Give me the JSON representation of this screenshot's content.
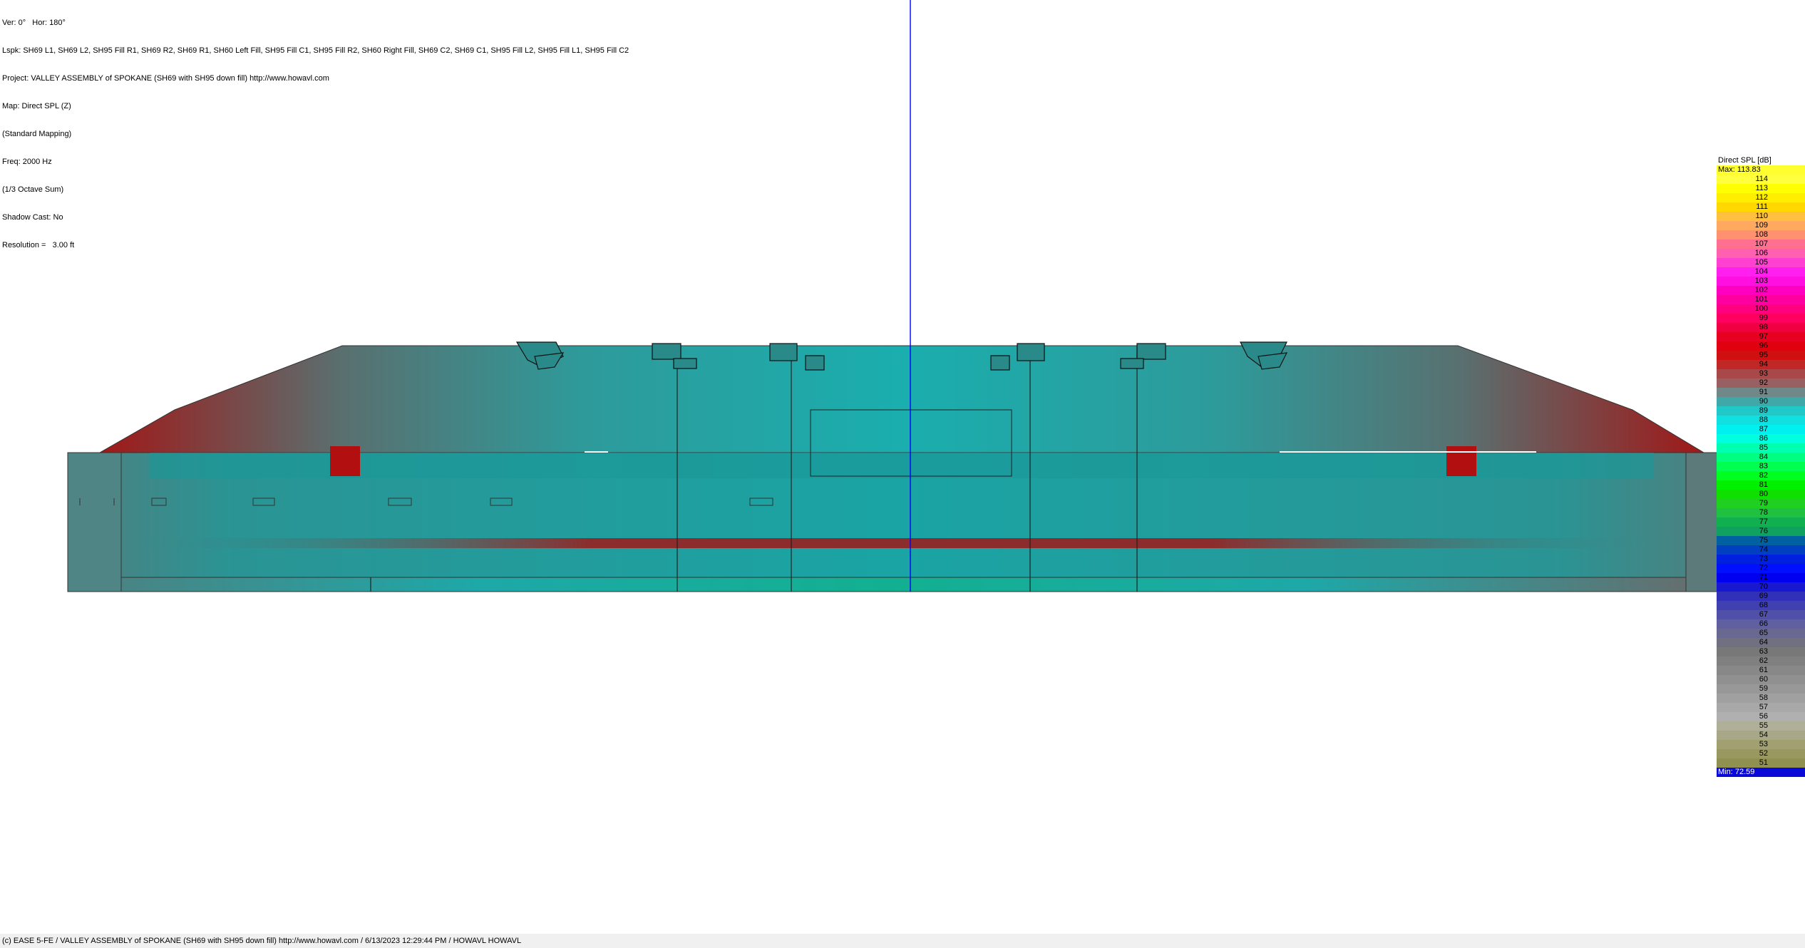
{
  "info_lines": [
    "Ver: 0°   Hor: 180°",
    "Lspk: SH69 L1, SH69 L2, SH95 Fill R1, SH69 R2, SH69 R1, SH60 Left Fill, SH95 Fill C1, SH95 Fill R2, SH60 Right Fill, SH69 C2, SH69 C1, SH95 Fill L2, SH95 Fill L1, SH95 Fill C2",
    "Project: VALLEY ASSEMBLY of SPOKANE (SH69 with SH95 down fill) http://www.howavl.com",
    "Map: Direct SPL (Z)",
    "(Standard Mapping)",
    "Freq: 2000 Hz",
    "(1/3 Octave Sum)",
    "Shadow Cast: No",
    "Resolution =   3.00 ft"
  ],
  "legend": {
    "title": "Direct SPL [dB]",
    "max": "Max:  113.83",
    "min": "Min:  72.59",
    "rows": [
      {
        "label": "114",
        "color": "#ffff40"
      },
      {
        "label": "113",
        "color": "#ffff00"
      },
      {
        "label": "112",
        "color": "#ffee00"
      },
      {
        "label": "111",
        "color": "#ffd800"
      },
      {
        "label": "110",
        "color": "#ffc040"
      },
      {
        "label": "109",
        "color": "#ffa860"
      },
      {
        "label": "108",
        "color": "#ff9070"
      },
      {
        "label": "107",
        "color": "#ff7090"
      },
      {
        "label": "106",
        "color": "#ff60b0"
      },
      {
        "label": "105",
        "color": "#ff40d0"
      },
      {
        "label": "104",
        "color": "#ff20f0"
      },
      {
        "label": "103",
        "color": "#ff10e0"
      },
      {
        "label": "102",
        "color": "#ff00c0"
      },
      {
        "label": "101",
        "color": "#ff00a0"
      },
      {
        "label": "100",
        "color": "#ff0080"
      },
      {
        "label": "99",
        "color": "#ff0060"
      },
      {
        "label": "98",
        "color": "#f00040"
      },
      {
        "label": "97",
        "color": "#e80020"
      },
      {
        "label": "96",
        "color": "#e00010"
      },
      {
        "label": "95",
        "color": "#d01010"
      },
      {
        "label": "94",
        "color": "#c02828"
      },
      {
        "label": "93",
        "color": "#a84848"
      },
      {
        "label": "92",
        "color": "#986060"
      },
      {
        "label": "91",
        "color": "#708888"
      },
      {
        "label": "90",
        "color": "#40a8a8"
      },
      {
        "label": "89",
        "color": "#20c8c8"
      },
      {
        "label": "88",
        "color": "#10e0e0"
      },
      {
        "label": "87",
        "color": "#00f0f0"
      },
      {
        "label": "86",
        "color": "#00ffe0"
      },
      {
        "label": "85",
        "color": "#00ffb0"
      },
      {
        "label": "84",
        "color": "#00ff80"
      },
      {
        "label": "83",
        "color": "#00ff50"
      },
      {
        "label": "82",
        "color": "#00ff20"
      },
      {
        "label": "81",
        "color": "#00f000"
      },
      {
        "label": "80",
        "color": "#10e000"
      },
      {
        "label": "79",
        "color": "#20d020"
      },
      {
        "label": "78",
        "color": "#20c040"
      },
      {
        "label": "77",
        "color": "#10b050"
      },
      {
        "label": "76",
        "color": "#10a060"
      },
      {
        "label": "75",
        "color": "#0060a0"
      },
      {
        "label": "74",
        "color": "#0040c0"
      },
      {
        "label": "73",
        "color": "#0020e0"
      },
      {
        "label": "72",
        "color": "#0010ff"
      },
      {
        "label": "71",
        "color": "#0000f0"
      },
      {
        "label": "70",
        "color": "#1818d0"
      },
      {
        "label": "69",
        "color": "#3030b8"
      },
      {
        "label": "68",
        "color": "#4040b0"
      },
      {
        "label": "67",
        "color": "#5050a8"
      },
      {
        "label": "66",
        "color": "#6060a0"
      },
      {
        "label": "65",
        "color": "#686890"
      },
      {
        "label": "64",
        "color": "#707080"
      },
      {
        "label": "63",
        "color": "#787878"
      },
      {
        "label": "62",
        "color": "#808080"
      },
      {
        "label": "61",
        "color": "#888888"
      },
      {
        "label": "60",
        "color": "#909090"
      },
      {
        "label": "59",
        "color": "#989898"
      },
      {
        "label": "58",
        "color": "#a0a0a0"
      },
      {
        "label": "57",
        "color": "#a8a8a8"
      },
      {
        "label": "56",
        "color": "#b0b0b0"
      },
      {
        "label": "55",
        "color": "#b0b098"
      },
      {
        "label": "54",
        "color": "#a8a888"
      },
      {
        "label": "53",
        "color": "#a0a070"
      },
      {
        "label": "52",
        "color": "#989860"
      },
      {
        "label": "51",
        "color": "#909050"
      }
    ]
  },
  "footer": "(c) EASE 5-FE  / VALLEY ASSEMBLY of SPOKANE (SH69 with SH95 down fill) http://www.howavl.com  / 6/13/2023 12:29:44 PM / HOWAVL HOWAVL",
  "colors": {
    "wall": "#2f9b9b",
    "hot": "#b01010",
    "cursor": "#0000ff",
    "floor": "#12a89a"
  }
}
